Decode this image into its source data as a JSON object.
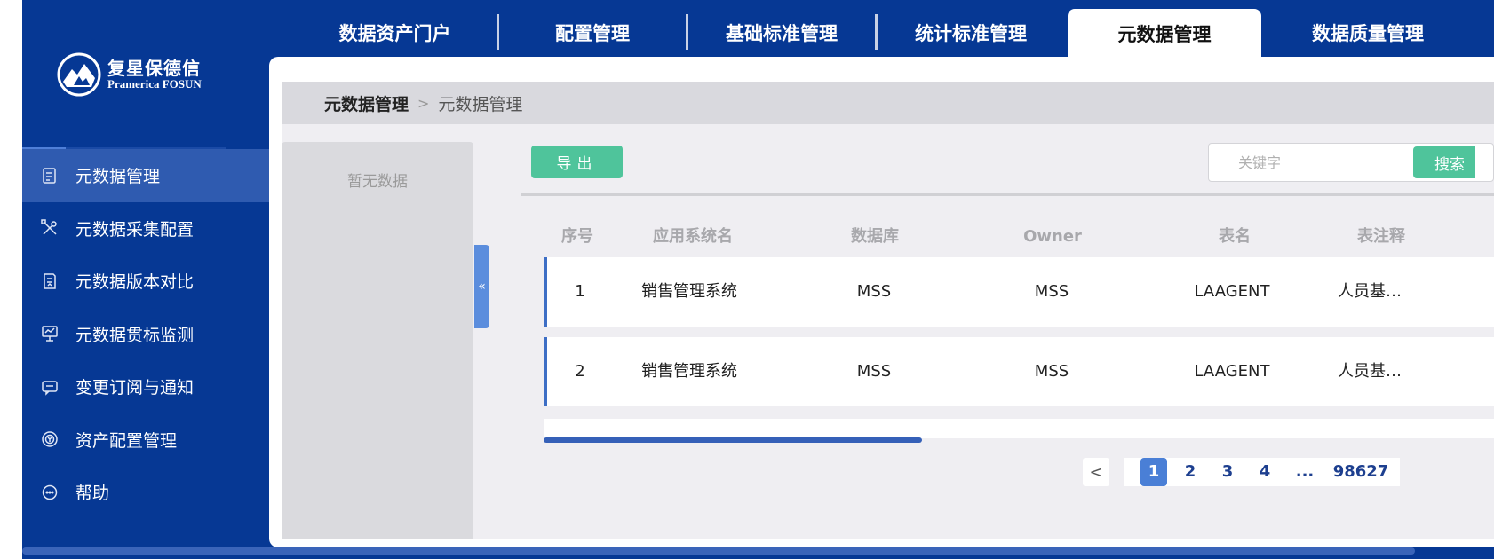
{
  "top_nav": {
    "tabs": [
      {
        "label": "数据资产门户"
      },
      {
        "label": "配置管理"
      },
      {
        "label": "基础标准管理"
      },
      {
        "label": "统计标准管理"
      },
      {
        "label": "元数据管理"
      },
      {
        "label": "数据质量管理"
      }
    ]
  },
  "logo": {
    "cn": "复星保德信",
    "en": "Pramerica FOSUN"
  },
  "sidebar": {
    "items": [
      {
        "label": "元数据管理",
        "icon": "document-list-icon"
      },
      {
        "label": "元数据采集配置",
        "icon": "tools-icon"
      },
      {
        "label": "元数据版本对比",
        "icon": "compare-doc-icon"
      },
      {
        "label": "元数据贯标监测",
        "icon": "monitor-board-icon"
      },
      {
        "label": "变更订阅与通知",
        "icon": "message-icon"
      },
      {
        "label": "资产配置管理",
        "icon": "asset-coin-icon"
      },
      {
        "label": "帮助",
        "icon": "help-chat-icon"
      }
    ]
  },
  "breadcrumb": {
    "level1": "元数据管理",
    "separator": ">",
    "level2": "元数据管理"
  },
  "tree": {
    "empty_text": "暂无数据",
    "collapse_icon": "«"
  },
  "toolbar": {
    "export_label": "导出",
    "search_placeholder": "关键字",
    "search_label": "搜索"
  },
  "table": {
    "columns": [
      "序号",
      "应用系统名",
      "数据库",
      "Owner",
      "表名",
      "表注释"
    ],
    "rows": [
      [
        "1",
        "销售管理系统",
        "MSS",
        "MSS",
        "LAAGENT",
        "人员基…"
      ],
      [
        "2",
        "销售管理系统",
        "MSS",
        "MSS",
        "LAAGENT",
        "人员基…"
      ]
    ]
  },
  "pagination": {
    "prev": "<",
    "pages": [
      "1",
      "2",
      "3",
      "4",
      "...",
      "98627"
    ],
    "current": "1"
  },
  "colors": {
    "brand_blue": "#063894",
    "accent_green": "#4fc49b",
    "active_blue": "#4a7fd6"
  }
}
